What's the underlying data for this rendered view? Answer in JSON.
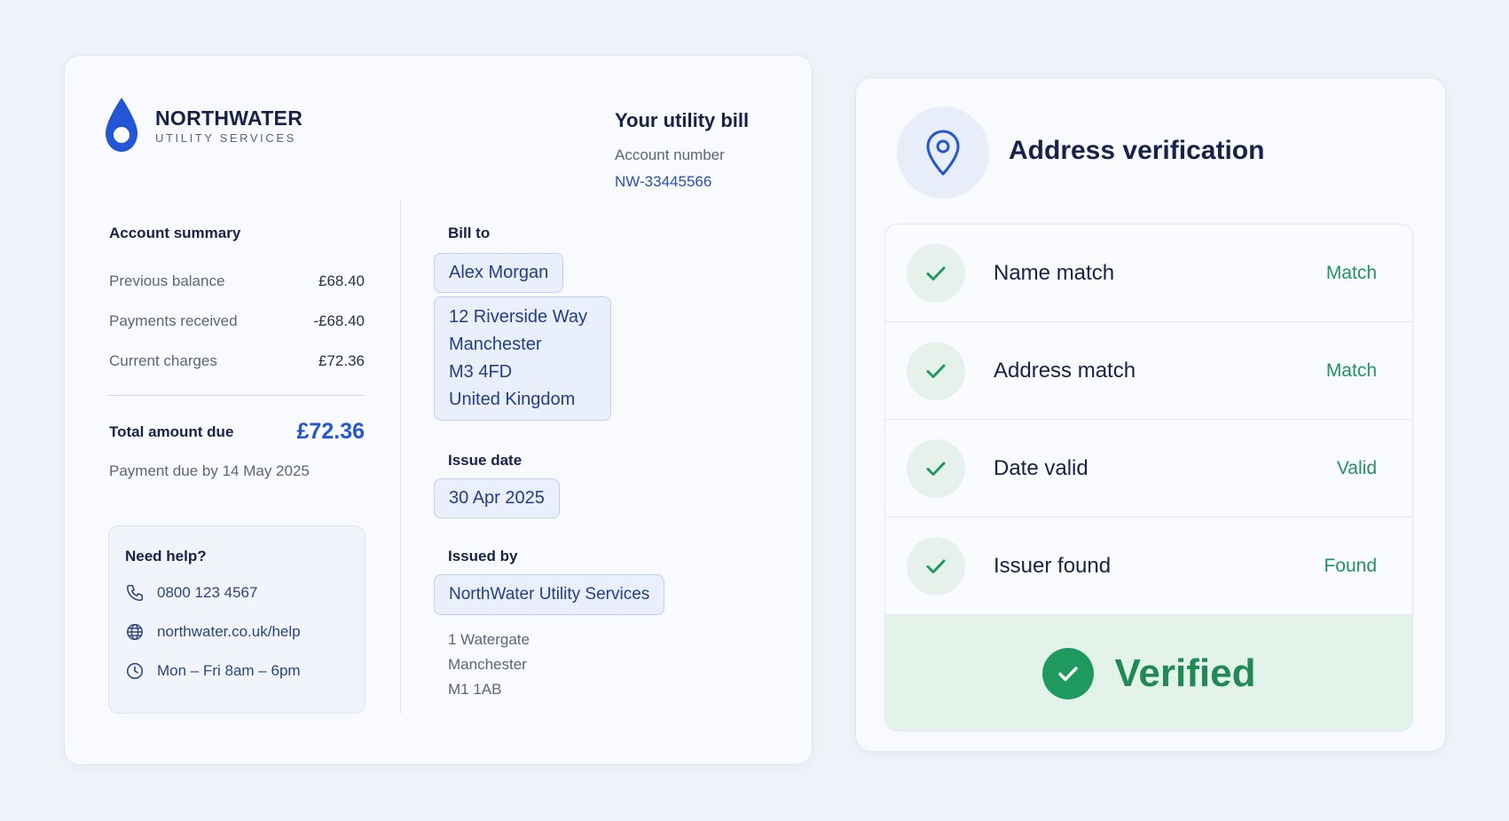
{
  "bill": {
    "logo": {
      "title": "NORTHWATER",
      "subtitle": "UTILITY SERVICES"
    },
    "heading": "Your utility bill",
    "account_label": "Account number",
    "account_number": "NW-33445566",
    "summary": {
      "title": "Account summary",
      "rows": [
        {
          "label": "Previous balance",
          "amount": "£68.40"
        },
        {
          "label": "Payments received",
          "amount": "-£68.40"
        },
        {
          "label": "Current charges",
          "amount": "£72.36"
        }
      ],
      "total_label": "Total amount due",
      "total_value": "£72.36",
      "due_text": "Payment due by 14 May 2025"
    },
    "help": {
      "title": "Need help?",
      "phone": "0800 123 4567",
      "website": "northwater.co.uk/help",
      "hours": "Mon – Fri 8am – 6pm"
    },
    "bill_to": {
      "label": "Bill to",
      "name": "Alex Morgan",
      "address": [
        "12 Riverside Way",
        "Manchester",
        "M3 4FD",
        "United Kingdom"
      ]
    },
    "issue_date": {
      "label": "Issue date",
      "value": "30 Apr 2025"
    },
    "issued_by": {
      "label": "Issued by",
      "name": "NorthWater Utility Services",
      "address": [
        "1 Watergate",
        "Manchester",
        "M1 1AB"
      ]
    }
  },
  "verification": {
    "title": "Address verification",
    "checks": [
      {
        "label": "Name match",
        "status": "Match"
      },
      {
        "label": "Address match",
        "status": "Match"
      },
      {
        "label": "Date valid",
        "status": "Valid"
      },
      {
        "label": "Issuer found",
        "status": "Found"
      }
    ],
    "result": "Verified"
  },
  "colors": {
    "accent": "#2356d6",
    "success": "#1f9a5e",
    "background": "#eef2f9"
  },
  "icons": {
    "logo": "water-drop-icon",
    "phone": "phone-icon",
    "web": "globe-icon",
    "hours": "clock-icon",
    "location": "location-pin-icon",
    "check": "checkmark-icon"
  }
}
